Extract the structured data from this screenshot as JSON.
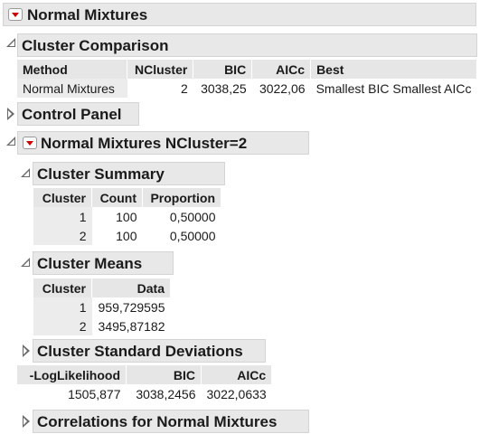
{
  "top_title": "Normal Mixtures",
  "cluster_comparison": {
    "title": "Cluster Comparison",
    "headers": [
      "Method",
      "NCluster",
      "BIC",
      "AICc",
      "Best"
    ],
    "row": [
      "Normal Mixtures",
      "2",
      "3038,25",
      "3022,06",
      "Smallest BIC Smallest AICc"
    ]
  },
  "control_panel": {
    "title": "Control Panel"
  },
  "nm_section": {
    "title": "Normal Mixtures NCluster=2"
  },
  "cluster_summary": {
    "title": "Cluster Summary",
    "headers": [
      "Cluster",
      "Count",
      "Proportion"
    ],
    "rows": [
      [
        "1",
        "100",
        "0,50000"
      ],
      [
        "2",
        "100",
        "0,50000"
      ]
    ]
  },
  "cluster_means": {
    "title": "Cluster Means",
    "headers": [
      "Cluster",
      "Data"
    ],
    "rows": [
      [
        "1",
        "959,729595"
      ],
      [
        "2",
        "3495,87182"
      ]
    ]
  },
  "cluster_sd": {
    "title": "Cluster Standard Deviations"
  },
  "fit_stats": {
    "headers": [
      "-LogLikelihood",
      "BIC",
      "AICc"
    ],
    "row": [
      "1505,877",
      "3038,2456",
      "3022,0633"
    ]
  },
  "correlations": {
    "title": "Correlations for Normal Mixtures"
  },
  "colors": {
    "header_bg": "#e8e8e8",
    "red_triangle": "#cc0000"
  }
}
